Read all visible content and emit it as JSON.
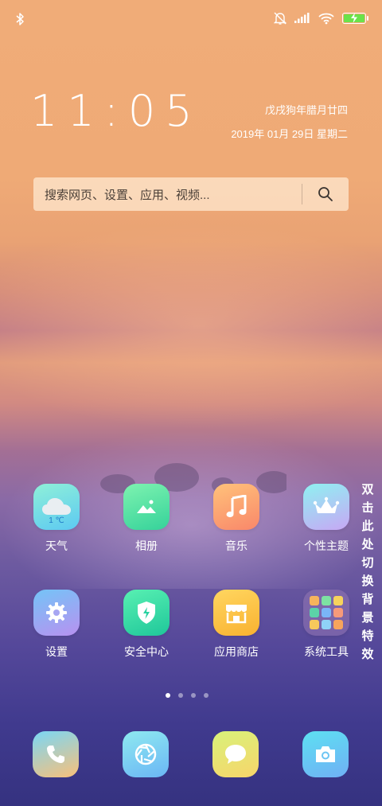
{
  "status_bar": {
    "left_icons": [
      "bluetooth-icon"
    ],
    "right_icons": [
      "mute-bell-icon",
      "signal-icon",
      "wifi-icon",
      "battery-charging-icon"
    ],
    "battery_color": "#6be24a"
  },
  "lockclock": {
    "time": "11:05",
    "lunar_date": "戊戌狗年腊月廿四",
    "date": "2019年 01月 29日 星期二"
  },
  "search": {
    "placeholder": "搜索网页、设置、应用、视频...",
    "icon": "search-icon"
  },
  "apps_row1": [
    {
      "label": "天气",
      "icon": "weather-cloud-icon",
      "temp": "1 ℃"
    },
    {
      "label": "相册",
      "icon": "gallery-icon"
    },
    {
      "label": "音乐",
      "icon": "music-note-icon"
    },
    {
      "label": "个性主题",
      "icon": "crown-icon"
    }
  ],
  "apps_row2": [
    {
      "label": "设置",
      "icon": "gear-icon"
    },
    {
      "label": "安全中心",
      "icon": "shield-icon"
    },
    {
      "label": "应用商店",
      "icon": "store-icon"
    },
    {
      "label": "系统工具",
      "icon": "folder-icon"
    }
  ],
  "side_hint": [
    "双",
    "击",
    "此",
    "处",
    "切",
    "换",
    "背",
    "景",
    "特",
    "效"
  ],
  "pages": {
    "count": 4,
    "active": 1
  },
  "dock": [
    {
      "icon": "phone-icon"
    },
    {
      "icon": "browser-aperture-icon"
    },
    {
      "icon": "message-icon"
    },
    {
      "icon": "camera-icon"
    }
  ]
}
